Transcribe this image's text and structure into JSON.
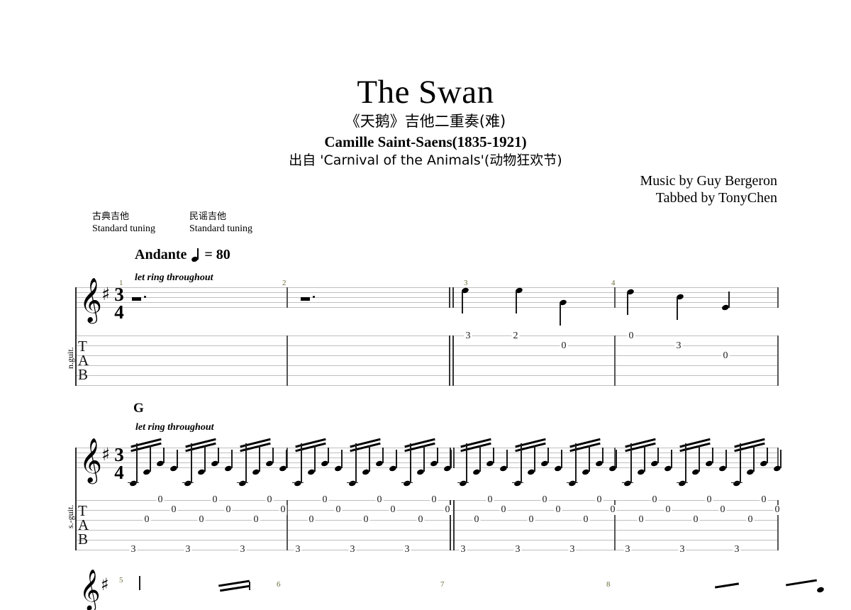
{
  "document": {
    "type": "guitar-tablature-sheet-music",
    "page_background": "#ffffff"
  },
  "header": {
    "title": "The Swan",
    "subtitle_cn": "《天鹅》吉他二重奏(难)",
    "composer": "Camille Saint-Saens(1835-1921)",
    "source": "出自 'Carnival of the Animals'(动物狂欢节)",
    "credit_music": "Music by Guy Bergeron",
    "credit_tab": "Tabbed by TonyChen"
  },
  "instruments": [
    {
      "name_cn": "古典吉他",
      "tuning": "Standard tuning",
      "side_label": "n.guit."
    },
    {
      "name_cn": "民谣吉他",
      "tuning": "Standard tuning",
      "side_label": "s.-guit."
    }
  ],
  "tempo": {
    "marking": "Andante",
    "note_icon": "quarter-note-icon",
    "equals": "= 80",
    "bpm": 80
  },
  "score": {
    "key_signature": "one-sharp",
    "key_name": "G major",
    "time_signature_top": "3",
    "time_signature_bottom": "4",
    "clef": "treble",
    "tab_letters": [
      "T",
      "A",
      "B"
    ]
  },
  "systems": [
    {
      "index": 1,
      "instrument_label": "n.guit.",
      "expression": "let ring throughout",
      "chord_symbol": "",
      "measures": [
        {
          "number": "1",
          "notation": [
            {
              "type": "rest",
              "value": "dotted-half"
            }
          ],
          "tab": []
        },
        {
          "number": "2",
          "notation": [
            {
              "type": "rest",
              "value": "dotted-half"
            }
          ],
          "tab": []
        },
        {
          "number": "3",
          "notation": [
            {
              "type": "note",
              "value": "quarter",
              "pitch_step": 8
            },
            {
              "type": "note",
              "value": "quarter",
              "pitch_step": 7
            },
            {
              "type": "note",
              "value": "quarter",
              "pitch_step": 5
            }
          ],
          "tab": [
            {
              "string": 1,
              "fret": "3"
            },
            {
              "string": 1,
              "fret": "2"
            },
            {
              "string": 2,
              "fret": "0"
            }
          ]
        },
        {
          "number": "4",
          "notation": [
            {
              "type": "note",
              "value": "quarter",
              "pitch_step": 7
            },
            {
              "type": "note",
              "value": "quarter",
              "pitch_step": 6
            },
            {
              "type": "note",
              "value": "quarter",
              "pitch_step": 4
            }
          ],
          "tab": [
            {
              "string": 1,
              "fret": "0"
            },
            {
              "string": 2,
              "fret": "3"
            },
            {
              "string": 3,
              "fret": "0"
            }
          ]
        }
      ]
    },
    {
      "index": 2,
      "instrument_label": "s.-guit.",
      "expression": "let ring throughout",
      "chord_symbol": "G",
      "measures": [
        {
          "number": "",
          "groups": 3,
          "tab_pattern": [
            {
              "string": 6,
              "fret": "3"
            },
            {
              "string": 3,
              "fret": "0"
            },
            {
              "string": 1,
              "fret": "0"
            },
            {
              "string": 2,
              "fret": "0"
            }
          ]
        },
        {
          "number": "",
          "groups": 3,
          "tab_pattern": [
            {
              "string": 6,
              "fret": "3"
            },
            {
              "string": 3,
              "fret": "0"
            },
            {
              "string": 1,
              "fret": "0"
            },
            {
              "string": 2,
              "fret": "0"
            }
          ]
        },
        {
          "number": "",
          "groups": 3,
          "tab_pattern": [
            {
              "string": 6,
              "fret": "3"
            },
            {
              "string": 3,
              "fret": "0"
            },
            {
              "string": 1,
              "fret": "0"
            },
            {
              "string": 2,
              "fret": "0"
            }
          ]
        },
        {
          "number": "",
          "groups": 3,
          "tab_pattern": [
            {
              "string": 6,
              "fret": "3"
            },
            {
              "string": 3,
              "fret": "0"
            },
            {
              "string": 1,
              "fret": "0"
            },
            {
              "string": 2,
              "fret": "0"
            }
          ]
        }
      ]
    },
    {
      "index": 3,
      "instrument_label": "",
      "expression": "",
      "chord_symbol": "",
      "partial": true,
      "measure_numbers": [
        "5",
        "6",
        "7",
        "8"
      ]
    }
  ]
}
